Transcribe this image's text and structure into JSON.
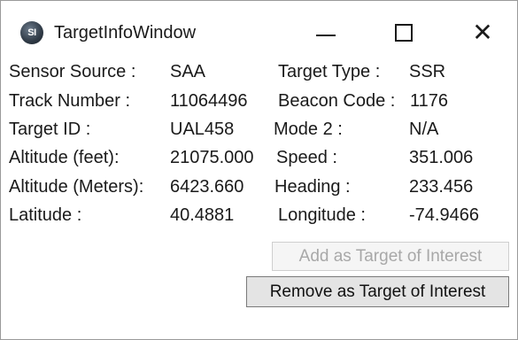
{
  "window": {
    "title": "TargetInfoWindow",
    "icon": "app-logo-icon",
    "icon_text": "SI"
  },
  "titlebar": {
    "minimize_icon": "minimize-icon",
    "maximize_icon": "maximize-icon",
    "close_icon": "close-icon",
    "close_glyph": "✕"
  },
  "fields": {
    "sensor_source": {
      "label": "Sensor Source :",
      "value": "SAA"
    },
    "target_type": {
      "label": "Target Type :",
      "value": "SSR"
    },
    "track_number": {
      "label": "Track Number :",
      "value": "11064496"
    },
    "beacon_code": {
      "label": "Beacon Code :",
      "value": "1176"
    },
    "target_id": {
      "label": "Target ID :",
      "value": "UAL458"
    },
    "mode2": {
      "label": "Mode 2 :",
      "value": "N/A"
    },
    "altitude_feet": {
      "label": "Altitude (feet):",
      "value": "21075.000"
    },
    "speed": {
      "label": "Speed :",
      "value": "351.006"
    },
    "altitude_meters": {
      "label": "Altitude (Meters):",
      "value": "6423.660"
    },
    "heading": {
      "label": "Heading :",
      "value": "233.456"
    },
    "latitude": {
      "label": "Latitude :",
      "value": "40.4881"
    },
    "longitude": {
      "label": "Longitude :",
      "value": "-74.9466"
    }
  },
  "buttons": {
    "add_target": "Add as Target of Interest",
    "remove_target": "Remove as Target of Interest"
  },
  "colors": {
    "disabled_text": "#a8a8a8",
    "button_face": "#e4e4e4"
  }
}
